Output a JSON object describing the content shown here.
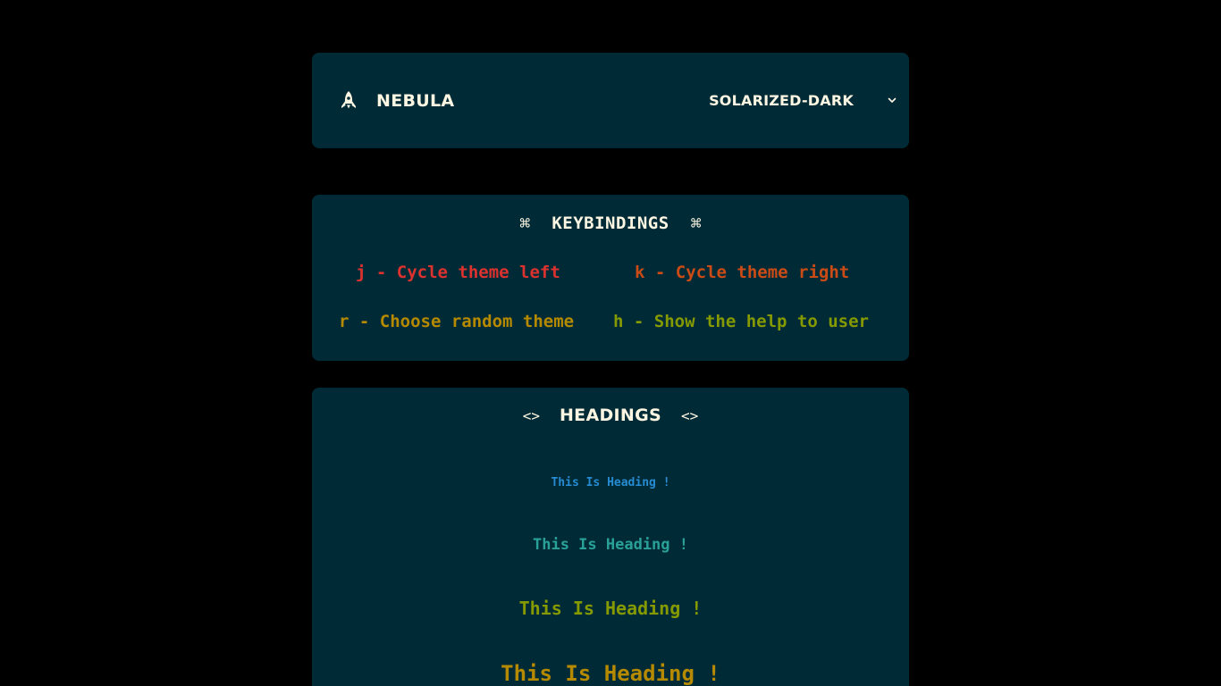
{
  "header": {
    "brand": "NEBULA",
    "brand_icon": "rocket-icon",
    "theme_selected": "SOLARIZED-DARK",
    "dropdown_icon": "chevron-down-icon"
  },
  "keybindings": {
    "title": "KEYBINDINGS",
    "title_icon": "command-icon",
    "title_symbol": "⌘",
    "items": [
      {
        "label": "j - Cycle theme left"
      },
      {
        "label": "k - Cycle theme right"
      },
      {
        "label": "r - Choose random theme"
      },
      {
        "label": "h - Show the help to user"
      }
    ]
  },
  "headings": {
    "title": "HEADINGS",
    "title_icon": "code-icon",
    "title_symbol": "<>",
    "items": [
      {
        "text": "This Is Heading !"
      },
      {
        "text": "This Is Heading !"
      },
      {
        "text": "This Is Heading !"
      },
      {
        "text": "This Is Heading !"
      }
    ]
  },
  "colors": {
    "page_background": "#000000",
    "card_background": "#002b36",
    "foreground": "#fdf6e3",
    "red": "#dc322f",
    "orange": "#cb4b16",
    "yellow": "#b58900",
    "green": "#859900",
    "blue": "#268bd2",
    "cyan": "#2aa198"
  }
}
